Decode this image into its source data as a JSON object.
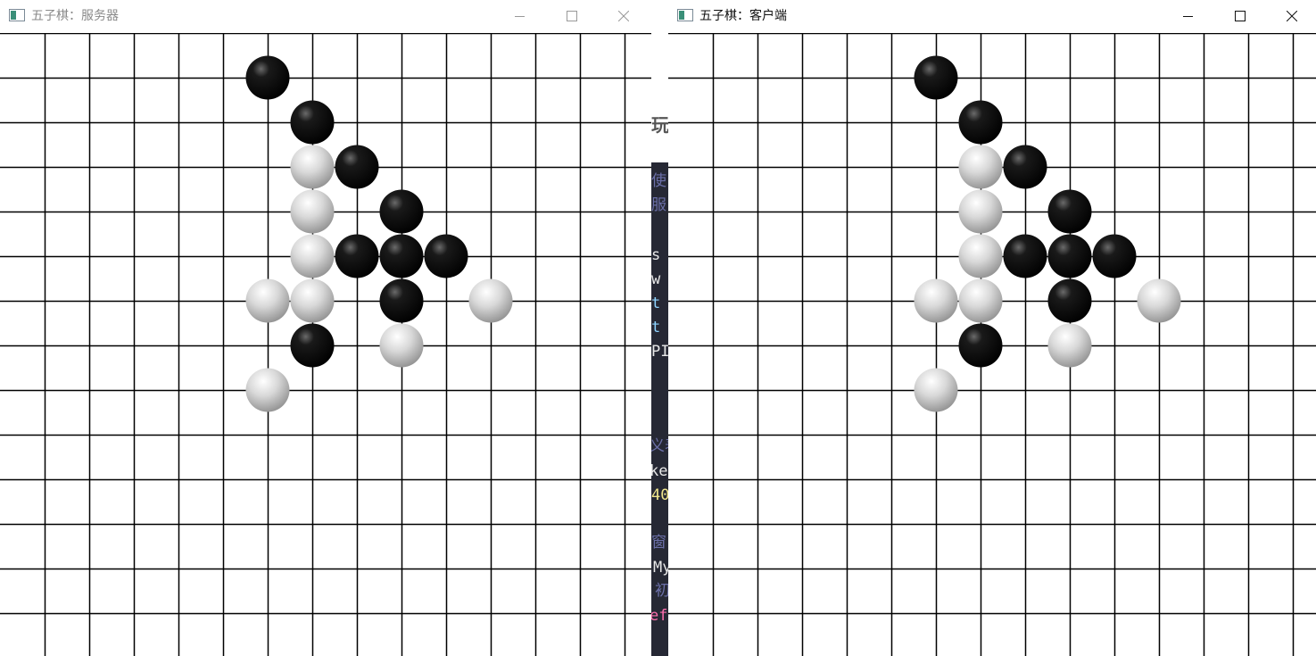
{
  "server_window": {
    "title": "五子棋：服务器"
  },
  "client_window": {
    "title": "五子棋：客户端"
  },
  "board": {
    "grid_lines_color": "#000000",
    "stones": [
      {
        "col": 6,
        "row": 1,
        "color": "black"
      },
      {
        "col": 7,
        "row": 2,
        "color": "black"
      },
      {
        "col": 7,
        "row": 3,
        "color": "white"
      },
      {
        "col": 8,
        "row": 3,
        "color": "black"
      },
      {
        "col": 7,
        "row": 4,
        "color": "white"
      },
      {
        "col": 9,
        "row": 4,
        "color": "black"
      },
      {
        "col": 7,
        "row": 5,
        "color": "white"
      },
      {
        "col": 8,
        "row": 5,
        "color": "black"
      },
      {
        "col": 9,
        "row": 5,
        "color": "black"
      },
      {
        "col": 10,
        "row": 5,
        "color": "black"
      },
      {
        "col": 6,
        "row": 6,
        "color": "white"
      },
      {
        "col": 7,
        "row": 6,
        "color": "white"
      },
      {
        "col": 9,
        "row": 6,
        "color": "black"
      },
      {
        "col": 11,
        "row": 6,
        "color": "white"
      },
      {
        "col": 7,
        "row": 7,
        "color": "black"
      },
      {
        "col": 9,
        "row": 7,
        "color": "white"
      },
      {
        "col": 6,
        "row": 8,
        "color": "white"
      }
    ]
  },
  "editor_snippets": [
    {
      "text": "玩",
      "color": "#555555"
    },
    {
      "text": "使",
      "color": "#6b6fa8"
    },
    {
      "text": "服",
      "color": "#6b6fa8"
    },
    {
      "text": "s",
      "color": "#e8e8e8"
    },
    {
      "text": "w",
      "color": "#e8e8e8"
    },
    {
      "text": "t",
      "color": "#8fd3ff"
    },
    {
      "text": "t",
      "color": "#8fd3ff"
    },
    {
      "text": "PIL",
      "color": "#e8e8e8"
    },
    {
      "text": "义表",
      "color": "#6b6fa8"
    },
    {
      "text": "ket",
      "color": "#e8e8e8"
    },
    {
      "text": "40",
      "color": "#f0e68c"
    },
    {
      "text": "窗",
      "color": "#6b6fa8"
    },
    {
      "text": "My",
      "color": "#e8e8e8"
    },
    {
      "text": "初",
      "color": "#6b6fa8"
    },
    {
      "text": "ef",
      "color": "#ff6fae"
    }
  ],
  "icons": [
    "app-icon",
    "minimize-icon",
    "maximize-icon",
    "close-icon"
  ]
}
